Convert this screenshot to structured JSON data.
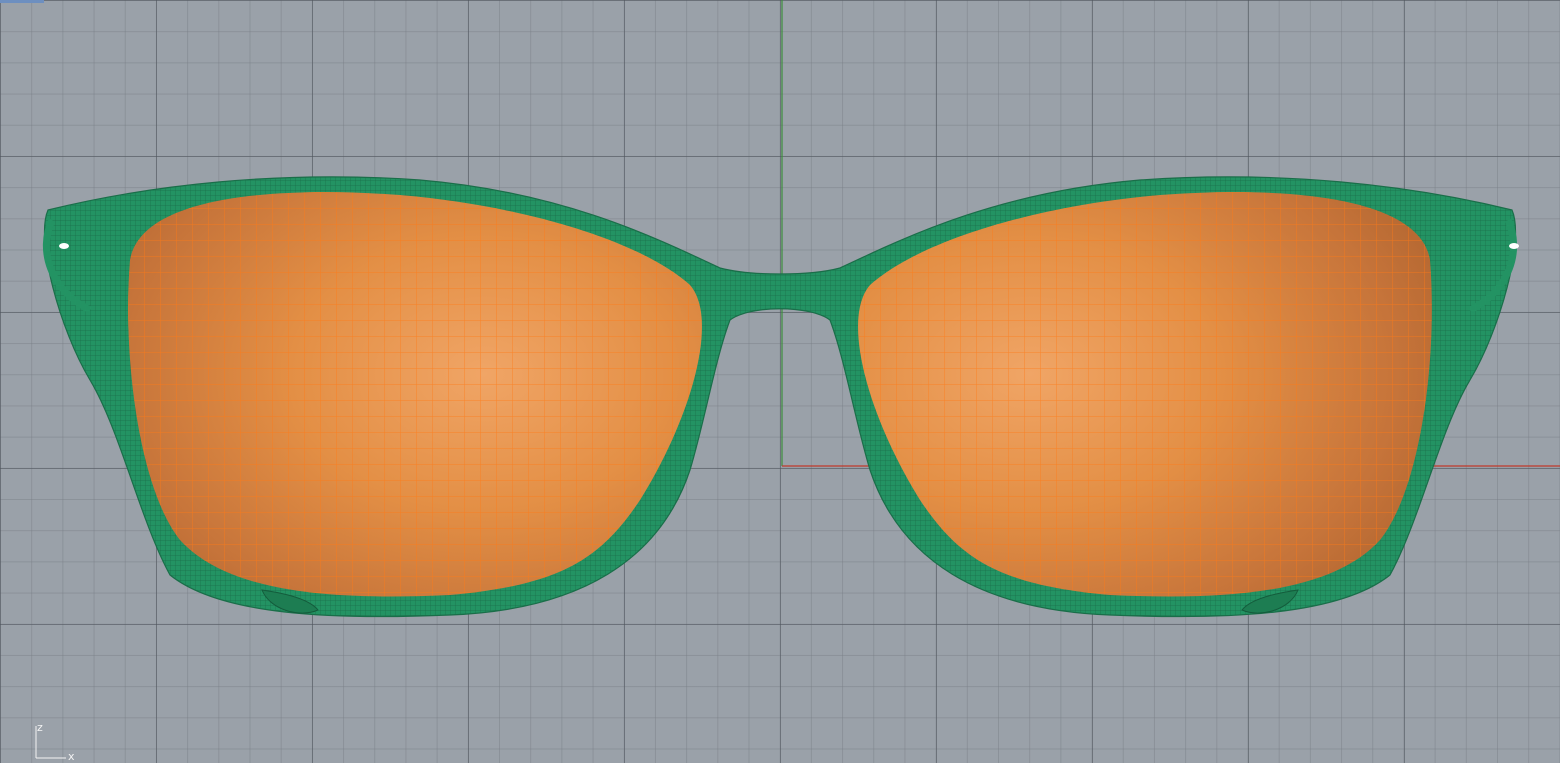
{
  "viewport": {
    "view": "front",
    "grid": true,
    "colors": {
      "background": "#9aa1a9",
      "grid_major": "#4e545c",
      "grid_minor": "#787e86",
      "axis_x": "#c0392b",
      "axis_z": "#3c8f3c",
      "frame_mesh": "#239363",
      "lens_surface": "#e48a3f",
      "lens_isocurves": "#ff7a16"
    }
  },
  "objects": [
    {
      "name": "frame",
      "kind": "mesh",
      "display": "wireframe-shaded"
    },
    {
      "name": "lens-left",
      "kind": "surface",
      "display": "shaded-isocurves"
    },
    {
      "name": "lens-right",
      "kind": "surface",
      "display": "shaded-isocurves"
    }
  ],
  "axis_widget": {
    "vertical_label": "z",
    "horizontal_label": "x"
  }
}
